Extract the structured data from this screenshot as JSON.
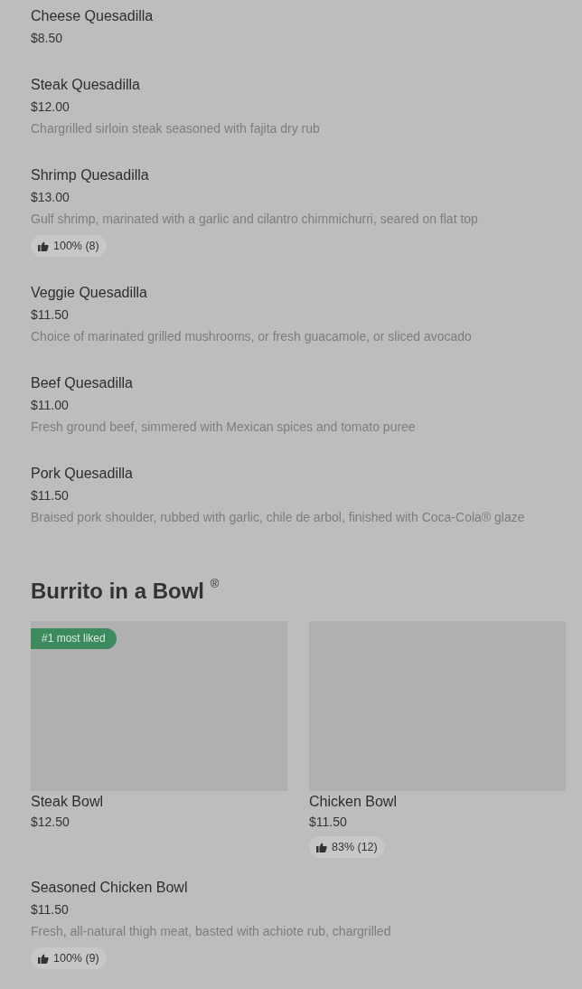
{
  "items": [
    {
      "title": "Cheese Quesadilla",
      "price": "$8.50"
    },
    {
      "title": "Steak Quesadilla",
      "price": "$12.00",
      "description": "Chargrilled sirloin steak seasoned with fajita dry rub"
    },
    {
      "title": "Shrimp Quesadilla",
      "price": "$13.00",
      "description": "Gulf shrimp, marinated with a garlic and cilantro chimmichurri, seared on flat top",
      "rating": "100% (8)"
    },
    {
      "title": "Veggie Quesadilla",
      "price": "$11.50",
      "description": "Choice of marinated grilled mushrooms, or fresh guacamole, or sliced avocado"
    },
    {
      "title": "Beef Quesadilla",
      "price": "$11.00",
      "description": "Fresh ground beef, simmered with Mexican spices and tomato puree"
    },
    {
      "title": "Pork Quesadilla",
      "price": "$11.50",
      "description": "Braised pork shoulder, rubbed with garlic, chile de arbol, finished with Coca-Cola® glaze"
    }
  ],
  "section": {
    "heading": "Burrito in a Bowl $^{®}$",
    "cards": [
      {
        "badge": "#1 most liked",
        "title": "Steak Bowl",
        "price": "$12.50"
      },
      {
        "title": "Chicken Bowl",
        "price": "$11.50",
        "rating": "83% (12)"
      }
    ],
    "items": [
      {
        "title": "Seasoned Chicken Bowl",
        "price": "$11.50",
        "description": "Fresh, all-natural thigh meat, basted with achiote rub, chargrilled",
        "rating": "100% (9)"
      }
    ]
  }
}
